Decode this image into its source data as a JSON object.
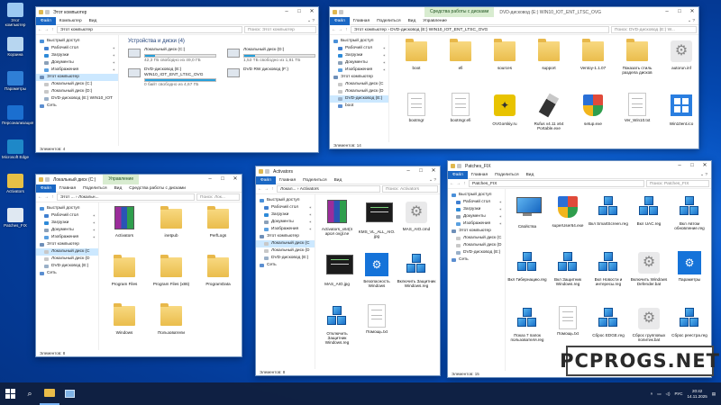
{
  "colors": {
    "accent": "#1a67c4",
    "folder": "#eabd4c",
    "selection": "#cce8ff",
    "context_tab": "#d8ecd0",
    "drive_bar": "#26a0da"
  },
  "desktop": {
    "icons": [
      {
        "label": "Этот компьютер",
        "icon": "computer-icon"
      },
      {
        "label": "Корзина",
        "icon": "recycle-bin-icon"
      },
      {
        "label": "Параметры",
        "icon": "settings-icon"
      },
      {
        "label": "Персонализация",
        "icon": "personalization-icon"
      },
      {
        "label": "Microsoft Edge",
        "icon": "edge-icon"
      },
      {
        "label": "Activators",
        "icon": "activators-icon"
      },
      {
        "label": "Patches_FIX",
        "icon": "patches-icon"
      }
    ]
  },
  "window_mycomputer": {
    "title": "Этот компьютер",
    "ribbon": [
      "Файл",
      "Компьютер",
      "Вид"
    ],
    "path": "Этот компьютер",
    "search": "Поиск: Этот компьютер",
    "section_title": "Устройства и диски (4)",
    "drives": [
      {
        "name": "Локальный диск (C:)",
        "free": "42,3 ГБ свободно из 49,0 ГБ",
        "fill": 0.14
      },
      {
        "name": "Локальный диск (D:)",
        "free": "1,53 ТБ свободно из 1,81 ТБ",
        "fill": 0.15
      },
      {
        "name": "DVD-дисковод (E:) WIN10_IOT_ENT_LTSC_OVG",
        "free": "0 байт свободно из 4,67 ГБ",
        "fill": 1.0
      },
      {
        "name": "DVD RW дисковод (F:)",
        "free": "",
        "fill": null
      }
    ],
    "sidebar": [
      {
        "label": "Быстрый доступ",
        "indent": false,
        "sel": false,
        "pin": false
      },
      {
        "label": "Рабочий стол",
        "indent": true,
        "sel": false,
        "pin": true
      },
      {
        "label": "Загрузки",
        "indent": true,
        "sel": false,
        "pin": true
      },
      {
        "label": "Документы",
        "indent": true,
        "sel": false,
        "pin": true
      },
      {
        "label": "Изображения",
        "indent": true,
        "sel": false,
        "pin": true
      },
      {
        "label": "Этот компьютер",
        "indent": false,
        "sel": true,
        "pin": false
      },
      {
        "label": "Локальный диск (C:)",
        "indent": true,
        "sel": false,
        "pin": false
      },
      {
        "label": "Локальный диск (D:)",
        "indent": true,
        "sel": false,
        "pin": false
      },
      {
        "label": "DVD-дисковод (E:) WIN10_IOT",
        "indent": true,
        "sel": false,
        "pin": false
      },
      {
        "label": "Сеть",
        "indent": false,
        "sel": false,
        "pin": false
      }
    ],
    "status": "Элементов: 4"
  },
  "window_dvd": {
    "title": "DVD-дисковод (E:) WIN10_IOT_ENT_LTSC_OVG",
    "context_tab": "Средства работы с дисками",
    "ribbon": [
      "Файл",
      "Главная",
      "Поделиться",
      "Вид",
      "Управление"
    ],
    "path": "Этот компьютер › DVD-дисковод (E:) WIN10_IOT_ENT_LTSC_OVG",
    "search": "Поиск: DVD-дисковод (E:) W...",
    "sidebar": [
      {
        "label": "Быстрый доступ",
        "indent": false,
        "sel": false,
        "pin": false
      },
      {
        "label": "Рабочий стол",
        "indent": true,
        "sel": false,
        "pin": true
      },
      {
        "label": "Загрузки",
        "indent": true,
        "sel": false,
        "pin": true
      },
      {
        "label": "Документы",
        "indent": true,
        "sel": false,
        "pin": true
      },
      {
        "label": "Изображения",
        "indent": true,
        "sel": false,
        "pin": true
      },
      {
        "label": "Этот компьютер",
        "indent": false,
        "sel": false,
        "pin": false
      },
      {
        "label": "Локальный диск (C",
        "indent": true,
        "sel": false,
        "pin": false
      },
      {
        "label": "Локальный диск (D",
        "indent": true,
        "sel": false,
        "pin": false
      },
      {
        "label": "DVD-дисковод (E:)",
        "indent": true,
        "sel": true,
        "pin": false
      },
      {
        "label": "boot",
        "indent": true,
        "sel": false,
        "pin": false
      }
    ],
    "items": [
      {
        "name": "boot",
        "kind": "folder"
      },
      {
        "name": "efi",
        "kind": "folder"
      },
      {
        "name": "sources",
        "kind": "folder"
      },
      {
        "name": "support",
        "kind": "folder"
      },
      {
        "name": "Ventoy-1.1.07",
        "kind": "folder"
      },
      {
        "name": "Показать стиль раздела дисков",
        "kind": "folder"
      },
      {
        "name": "autorun.inf",
        "kind": "gear"
      },
      {
        "name": "bootmgr",
        "kind": "doc"
      },
      {
        "name": "bootmgr.efi",
        "kind": "doc"
      },
      {
        "name": "OVGorskiy.ru",
        "kind": "ovg"
      },
      {
        "name": "Rufus v4.11 x64 Portable.exe",
        "kind": "usb"
      },
      {
        "name": "setup.exe",
        "kind": "setup"
      },
      {
        "name": "Ver_Win10.txt",
        "kind": "doc"
      },
      {
        "name": "Win10ent.ico",
        "kind": "winlogo"
      }
    ],
    "status": "Элементов: 14"
  },
  "window_c": {
    "title": "Локальный диск (C:)",
    "context_tab": "Управление",
    "ribbon": [
      "Файл",
      "Главная",
      "Поделиться",
      "Вид",
      "Средства работы с дисками"
    ],
    "path": "Этот ... › Локальн...",
    "search": "Поиск: Лок...",
    "sidebar": [
      {
        "label": "Быстрый доступ",
        "indent": false,
        "sel": false,
        "pin": false
      },
      {
        "label": "Рабочий стол",
        "indent": true,
        "sel": false,
        "pin": true
      },
      {
        "label": "Загрузки",
        "indent": true,
        "sel": false,
        "pin": true
      },
      {
        "label": "Документы",
        "indent": true,
        "sel": false,
        "pin": true
      },
      {
        "label": "Изображения",
        "indent": true,
        "sel": false,
        "pin": true
      },
      {
        "label": "Этот компьютер",
        "indent": false,
        "sel": false,
        "pin": false
      },
      {
        "label": "Локальный диск (C",
        "indent": true,
        "sel": true,
        "pin": false
      },
      {
        "label": "Локальный диск (D",
        "indent": true,
        "sel": false,
        "pin": false
      },
      {
        "label": "DVD-дисковод (E:)",
        "indent": true,
        "sel": false,
        "pin": false
      },
      {
        "label": "Сеть",
        "indent": false,
        "sel": false,
        "pin": false
      }
    ],
    "items": [
      {
        "name": "Activators",
        "kind": "winrar"
      },
      {
        "name": "inetpub",
        "kind": "folder"
      },
      {
        "name": "PerfLogs",
        "kind": "folder"
      },
      {
        "name": "Program Files",
        "kind": "folder"
      },
      {
        "name": "Program Files (x86)",
        "kind": "folder"
      },
      {
        "name": "ProgramData",
        "kind": "folder"
      },
      {
        "name": "Windows",
        "kind": "folder"
      },
      {
        "name": "Пользователи",
        "kind": "folder"
      }
    ],
    "status": "Элементов: 8"
  },
  "window_activators": {
    "title": "Activators",
    "ribbon": [
      "Файл",
      "Главная",
      "Поделиться",
      "Вид"
    ],
    "path": "Локал... › Activators",
    "search": "Поиск: Activators",
    "sidebar": [
      {
        "label": "Быстрый доступ",
        "indent": false,
        "sel": false,
        "pin": false
      },
      {
        "label": "Рабочий стол",
        "indent": true,
        "sel": false,
        "pin": true
      },
      {
        "label": "Загрузки",
        "indent": true,
        "sel": false,
        "pin": true
      },
      {
        "label": "Документы",
        "indent": true,
        "sel": false,
        "pin": true
      },
      {
        "label": "Изображения",
        "indent": true,
        "sel": false,
        "pin": true
      },
      {
        "label": "Этот компьютер",
        "indent": false,
        "sel": false,
        "pin": false
      },
      {
        "label": "Локальный диск (C",
        "indent": true,
        "sel": true,
        "pin": false
      },
      {
        "label": "Локальный диск (D",
        "indent": true,
        "sel": false,
        "pin": false
      },
      {
        "label": "DVD-дисковод (E:)",
        "indent": true,
        "sel": false,
        "pin": false
      },
      {
        "label": "Сеть",
        "indent": false,
        "sel": false,
        "pin": false
      }
    ],
    "items": [
      {
        "name": "Activators_x64(п арол ovgl.ne",
        "kind": "winrar"
      },
      {
        "name": "KMS_VL_ALL_AIO. jpg",
        "kind": "darkimg"
      },
      {
        "name": "MAS_AIO.cmd",
        "kind": "gear"
      },
      {
        "name": "MAS_AIO.jpg",
        "kind": "darkimg"
      },
      {
        "name": "Безопасность Windows",
        "kind": "bluebox"
      },
      {
        "name": "Включить Защитник Windows.reg",
        "kind": "reg"
      },
      {
        "name": "Отключить Защитник Windows.reg",
        "kind": "reg"
      },
      {
        "name": "Помощь.txt",
        "kind": "doc"
      }
    ],
    "status": "Элементов: 8"
  },
  "window_patches": {
    "title": "Patches_FIX",
    "ribbon": [
      "Файл",
      "Главная",
      "Поделиться",
      "Вид"
    ],
    "path": "Patches_FIX",
    "search": "Поиск: Patches_FIX",
    "sidebar": [
      {
        "label": "Быстрый доступ",
        "indent": false,
        "sel": false,
        "pin": false
      },
      {
        "label": "Рабочий стол",
        "indent": true,
        "sel": false,
        "pin": true
      },
      {
        "label": "Загрузки",
        "indent": true,
        "sel": false,
        "pin": true
      },
      {
        "label": "Документы",
        "indent": true,
        "sel": false,
        "pin": true
      },
      {
        "label": "Изображения",
        "indent": true,
        "sel": false,
        "pin": true
      },
      {
        "label": "Этот компьютер",
        "indent": false,
        "sel": false,
        "pin": false
      },
      {
        "label": "Локальный диск (C",
        "indent": true,
        "sel": false,
        "pin": false
      },
      {
        "label": "Локальный диск (D",
        "indent": true,
        "sel": false,
        "pin": false
      },
      {
        "label": "DVD-дисковод (E:)",
        "indent": true,
        "sel": false,
        "pin": false
      },
      {
        "label": "Сеть",
        "indent": false,
        "sel": false,
        "pin": false
      }
    ],
    "items": [
      {
        "name": "Свойства",
        "kind": "monitor"
      },
      {
        "name": "superUser64.exe",
        "kind": "setup"
      },
      {
        "name": "Вкл SmartScreen.reg",
        "kind": "reg"
      },
      {
        "name": "Вкл UAC.reg",
        "kind": "reg"
      },
      {
        "name": "Вкл Автом обновление.reg",
        "kind": "reg"
      },
      {
        "name": "Вкл Гибернацию.reg",
        "kind": "reg"
      },
      {
        "name": "Вкл Защитник Windows.reg",
        "kind": "reg"
      },
      {
        "name": "Вкл Новости и интересы.reg",
        "kind": "reg"
      },
      {
        "name": "Включить Windows Defender.bat",
        "kind": "gear"
      },
      {
        "name": "Параметры",
        "kind": "bluebox"
      },
      {
        "name": "Показ 7 папок пользователя.reg",
        "kind": "reg"
      },
      {
        "name": "Помощь.txt",
        "kind": "doc"
      },
      {
        "name": "Сброс EDGE.reg",
        "kind": "reg"
      },
      {
        "name": "Сброс групповых политик.bat",
        "kind": "gear"
      },
      {
        "name": "Сброс реестра.reg",
        "kind": "reg"
      }
    ],
    "status": "Элементов: 15"
  },
  "taskbar": {
    "lang": "РУС",
    "time": "20:42",
    "date": "14.11.2025"
  },
  "watermark": "PCPROGS.NET"
}
